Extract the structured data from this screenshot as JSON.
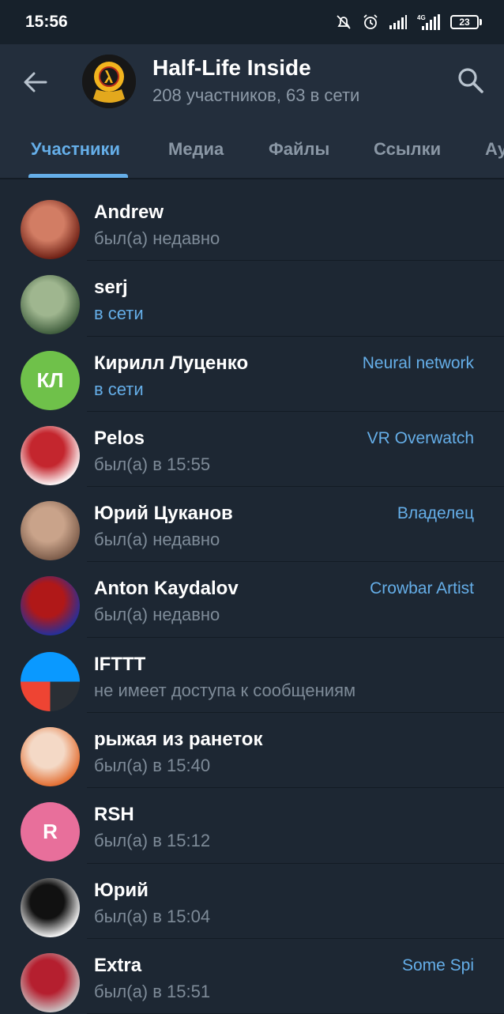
{
  "status_bar": {
    "time": "15:56",
    "network": "4G",
    "battery": "23"
  },
  "header": {
    "title": "Half-Life Inside",
    "subtitle": "208 участников, 63 в сети"
  },
  "tabs": [
    {
      "label": "Участники",
      "active": true
    },
    {
      "label": "Медиа"
    },
    {
      "label": "Файлы"
    },
    {
      "label": "Ссылки"
    },
    {
      "label": "Ау"
    }
  ],
  "members": [
    {
      "name": "Andrew",
      "status": "был(а) недавно",
      "online": false,
      "role": "",
      "avatar": {
        "type": "photo",
        "colors": [
          "#6b1d12",
          "#d27d64"
        ]
      }
    },
    {
      "name": "serj",
      "status": "в сети",
      "online": true,
      "role": "",
      "avatar": {
        "type": "photo",
        "colors": [
          "#3c5a3a",
          "#9fb68f"
        ]
      }
    },
    {
      "name": "Кирилл Луценко",
      "status": "в сети",
      "online": true,
      "role": "Neural network",
      "avatar": {
        "type": "initials",
        "initials": "КЛ",
        "color": "#6fc14a"
      }
    },
    {
      "name": "Pelos",
      "status": "был(а) в 15:55",
      "online": false,
      "role": "VR Overwatch",
      "avatar": {
        "type": "photo",
        "colors": [
          "#ffffff",
          "#c4262e"
        ]
      }
    },
    {
      "name": "Юрий Цуканов",
      "status": "был(а) недавно",
      "online": false,
      "role": "Владелец",
      "avatar": {
        "type": "photo",
        "colors": [
          "#7a5a48",
          "#c9a38a"
        ]
      }
    },
    {
      "name": "Anton Kaydalov",
      "status": "был(а) недавно",
      "online": false,
      "role": "Crowbar Artist",
      "avatar": {
        "type": "photo",
        "colors": [
          "#2030a0",
          "#b01818"
        ]
      }
    },
    {
      "name": "IFTTT",
      "status": "не имеет доступа к сообщениям",
      "online": false,
      "role": "",
      "avatar": {
        "type": "photo",
        "colors": [
          "#0a99ff",
          "#ee4433"
        ]
      }
    },
    {
      "name": "рыжая из ранеток",
      "status": "был(а) в 15:40",
      "online": false,
      "role": "",
      "avatar": {
        "type": "photo",
        "colors": [
          "#e26a2c",
          "#f4d9c6"
        ]
      }
    },
    {
      "name": "RSH",
      "status": "был(а) в 15:12",
      "online": false,
      "role": "",
      "avatar": {
        "type": "initials",
        "initials": "R",
        "color": "#e86f9b"
      }
    },
    {
      "name": "Юрий",
      "status": "был(а) в 15:04",
      "online": false,
      "role": "",
      "avatar": {
        "type": "photo",
        "colors": [
          "#ffffff",
          "#111111"
        ]
      }
    },
    {
      "name": "Extra",
      "status": "был(а) в 15:51",
      "online": false,
      "role": "Some Spi",
      "avatar": {
        "type": "photo",
        "colors": [
          "#c9c9c9",
          "#b51f2f"
        ]
      }
    }
  ]
}
